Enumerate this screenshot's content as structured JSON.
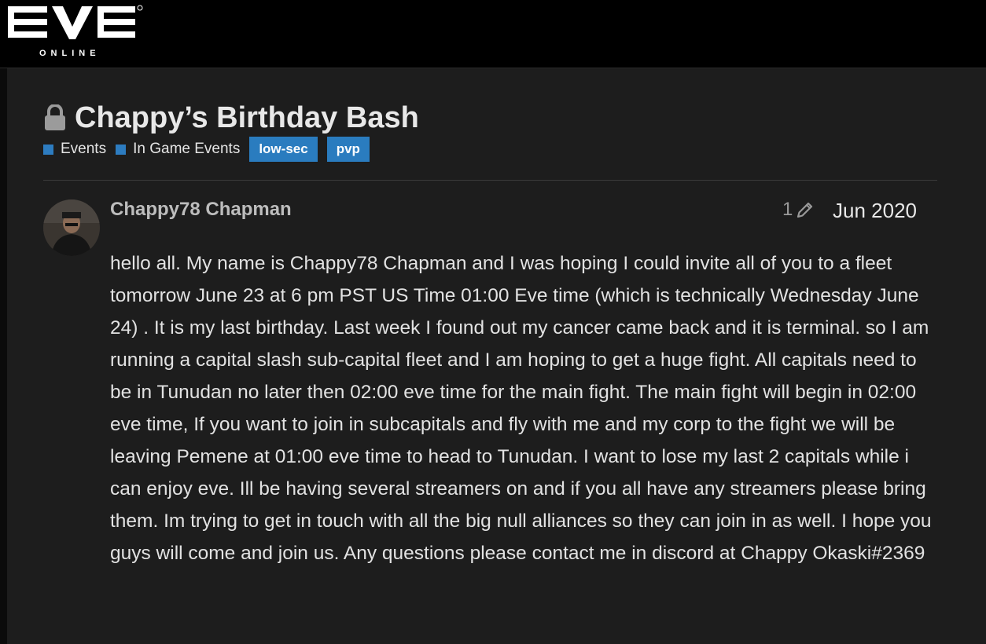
{
  "header": {
    "logo_text": "EVE",
    "logo_subtext": "ONLINE"
  },
  "topic": {
    "title": "Chappy’s Birthday Bash",
    "lock_icon": "lock-icon",
    "categories": [
      {
        "label": "Events",
        "color": "#2d7cc0"
      },
      {
        "label": "In Game Events",
        "color": "#2d7cc0"
      }
    ],
    "tags": [
      "low-sec",
      "pvp"
    ]
  },
  "post": {
    "username": "Chappy78 Chapman",
    "edit_count": "1",
    "edit_icon": "pencil-icon",
    "date": "Jun 2020",
    "body": "hello all. My name is Chappy78 Chapman and I was hoping I could invite all of you to a fleet tomorrow June 23 at 6 pm PST US Time 01:00 Eve time (which is technically Wednesday June 24) . It is my last birthday. Last week I found out my cancer came back and it is terminal. so I am running a capital slash sub-capital fleet and I am hoping to get a huge fight. All capitals need to be in Tunudan no later then 02:00 eve time for the main fight. The main fight will begin in 02:00 eve time, If you want to join in subcapitals and fly with me and my corp to the fight we will be leaving Pemene at 01:00 eve time to head to Tunudan. I want to lose my last 2 capitals while i can enjoy eve. Ill be having several streamers on and if you all have any streamers please bring them. Im trying to get in touch with all the big null alliances so they can join in as well. I hope you guys will come and join us. Any questions please contact me in discord at Chappy Okaski#2369"
  },
  "colors": {
    "accent": "#2a7cbf",
    "background": "#1d1d1d",
    "header": "#000000"
  }
}
